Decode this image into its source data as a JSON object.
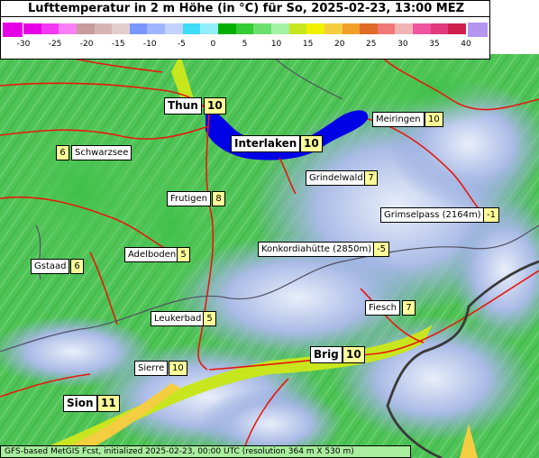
{
  "title": "Lufttemperatur in 2 m Höhe (in °C) für So, 2025-02-23, 13:00 MEZ",
  "scale": {
    "ticks": [
      "-30",
      "-25",
      "-20",
      "-15",
      "-10",
      "-5",
      "0",
      "5",
      "10",
      "15",
      "20",
      "25",
      "30",
      "35",
      "40"
    ],
    "colors": [
      "#e600e6",
      "#f33af3",
      "#f780f7",
      "#c89b9b",
      "#d7b4b4",
      "#e6cdcd",
      "#7a96ff",
      "#9fb5ff",
      "#c3d1ff",
      "#3ddcf7",
      "#92eefa",
      "#00b000",
      "#34cc34",
      "#6ce06c",
      "#a4f2a4",
      "#c8e61e",
      "#f0f000",
      "#f5cd41",
      "#f0a028",
      "#e06a28",
      "#f07878",
      "#f0b4b4",
      "#f054a0",
      "#e03a7c",
      "#d02050"
    ],
    "low_end_color": "#e600e6",
    "high_end_color": "#b496f0"
  },
  "stations": [
    {
      "name": "Thun",
      "value": "10",
      "big": true
    },
    {
      "name": "Interlaken",
      "value": "10",
      "big": true
    },
    {
      "name": "Meiringen",
      "value": "10",
      "big": false
    },
    {
      "name": "Schwarzsee",
      "value": "6",
      "big": false
    },
    {
      "name": "Grindelwald",
      "value": "7",
      "big": false
    },
    {
      "name": "Frutigen",
      "value": "8",
      "big": false
    },
    {
      "name": "Grimselpass (2164m)",
      "value": "-1",
      "big": false
    },
    {
      "name": "Konkordiahütte (2850m)",
      "value": "-5",
      "big": false
    },
    {
      "name": "Adelboden",
      "value": "5",
      "big": false
    },
    {
      "name": "Gstaad",
      "value": "6",
      "big": false
    },
    {
      "name": "Fiesch",
      "value": "7",
      "big": false
    },
    {
      "name": "Leukerbad",
      "value": "5",
      "big": false
    },
    {
      "name": "Brig",
      "value": "10",
      "big": true
    },
    {
      "name": "Sierre",
      "value": "10",
      "big": false
    },
    {
      "name": "Sion",
      "value": "11",
      "big": true
    }
  ],
  "footer": "GFS-based MetGIS Fcst, initialized 2025-02-23, 00:00 UTC  (resolution 364 m X 530 m)"
}
